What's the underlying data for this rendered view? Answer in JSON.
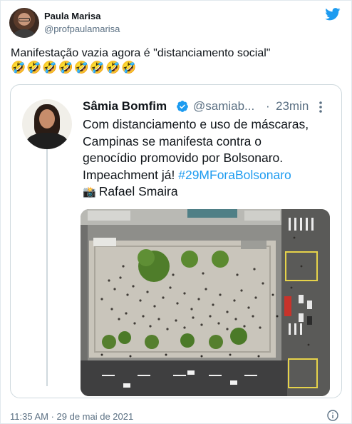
{
  "tweet": {
    "author_name": "Paula Marisa",
    "author_handle": "@profpaulamarisa",
    "text": "Manifestação vazia agora é \"distanciamento social\"",
    "emojis": "🤣🤣🤣🤣🤣🤣🤣🤣",
    "timestamp": "11:35 AM · 29 de mai de 2021"
  },
  "quoted": {
    "name": "Sâmia Bomfim",
    "handle": "@samiab...",
    "separator": "·",
    "time": "23min",
    "lines": [
      "Com distanciamento e uso de máscaras,",
      "Campinas se manifesta contra o",
      "genocídio promovido por Bolsonaro."
    ],
    "line4_text": "Impeachment já! ",
    "hashtag": "#29MForaBolsonaro",
    "camera_emoji": "📸",
    "photo_credit": "Rafael Smaira"
  },
  "icons": {
    "brand": "twitter-bird-icon",
    "verified": "verified-badge-icon",
    "more": "more-options-icon",
    "info": "info-icon"
  },
  "colors": {
    "brand_blue": "#1d9bf0",
    "secondary_text": "#5b7083",
    "border": "#cfd9de"
  }
}
